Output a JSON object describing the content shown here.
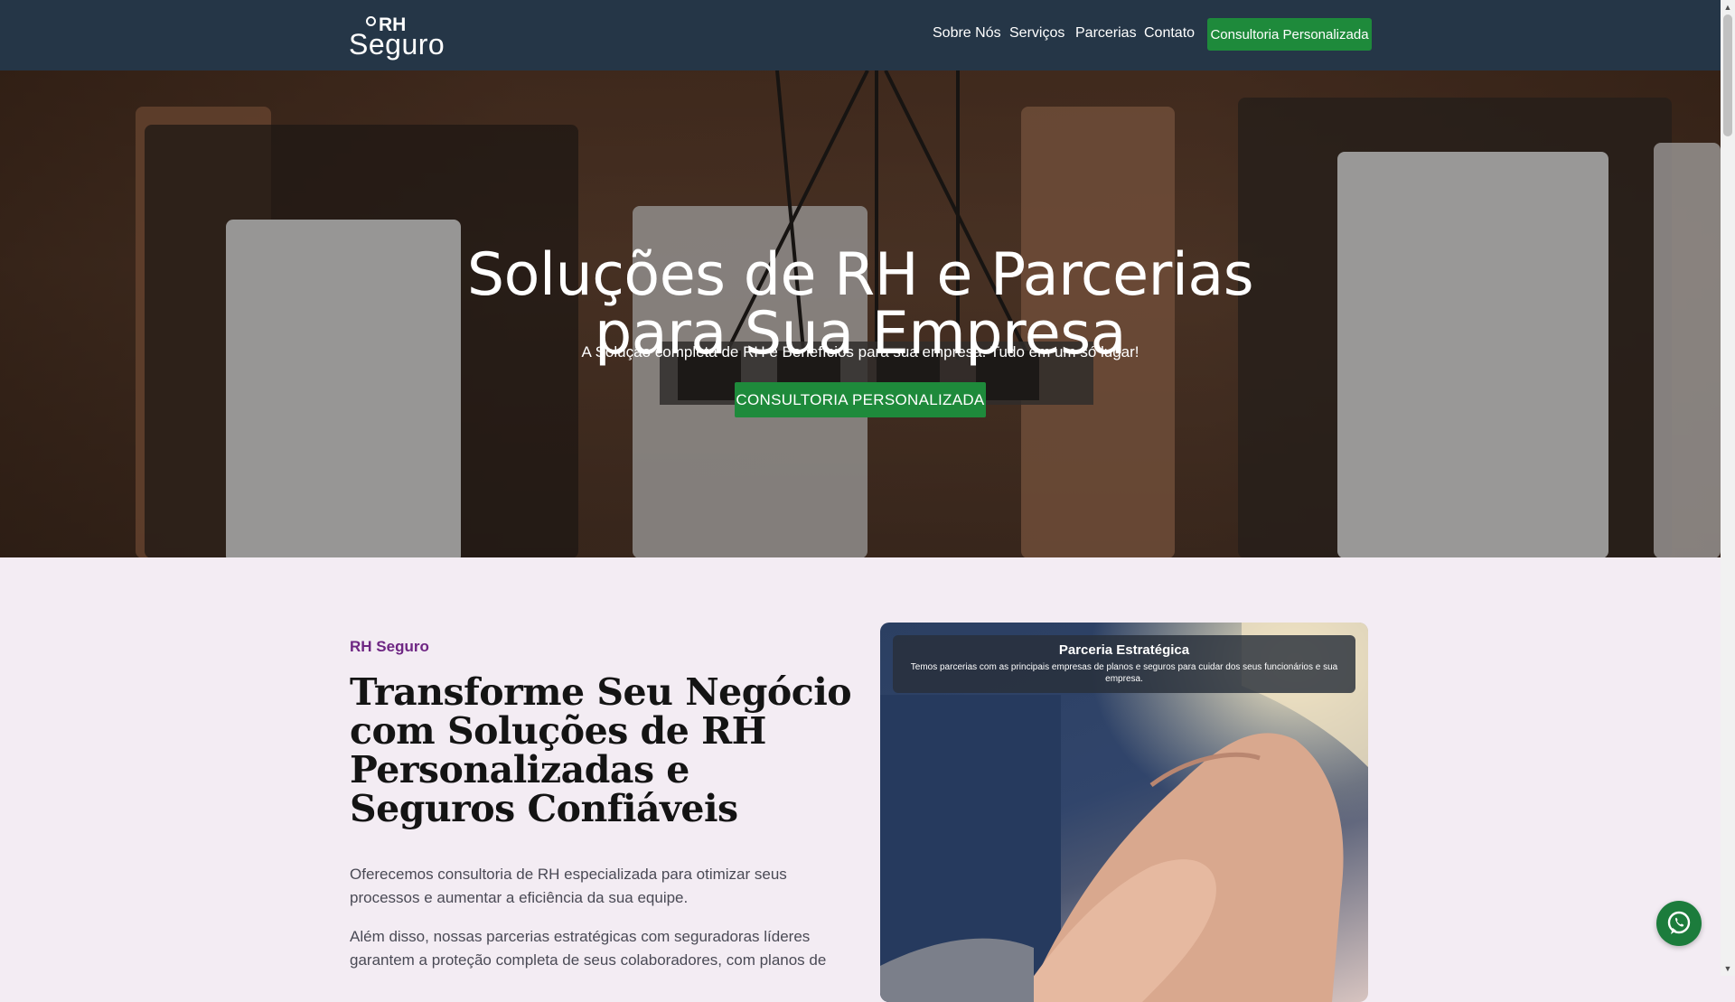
{
  "nav": {
    "logo_top": "RH",
    "logo_bottom": "Seguro",
    "links": [
      "Sobre Nós",
      "Serviços",
      "Parcerias",
      "Contato"
    ],
    "cta": "Consultoria Personalizada"
  },
  "hero": {
    "title_line1": "Soluções de RH e Parcerias",
    "title_line2": "para Sua Empresa",
    "subtitle": "A Solução completa de RH e Benefícios para sua empresa. Tudo em um só lugar!",
    "button": "CONSULTORIA PERSONALIZADA"
  },
  "about": {
    "kicker": "RH Seguro",
    "title": "Transforme Seu Negócio com Soluções de RH Personalizadas e Seguros Confiáveis",
    "paragraphs": [
      "Oferecemos consultoria de RH especializada para otimizar seus processos e aumentar a eficiência da sua equipe.",
      "Além disso, nossas parcerias estratégicas com seguradoras líderes garantem a proteção completa de seus colaboradores, com planos de"
    ],
    "card": {
      "title": "Parceria Estratégica",
      "text": "Temos parcerias com as principais empresas de planos e seguros para cuidar dos seus funcionários e sua empresa."
    }
  },
  "colors": {
    "navbar": "#253647",
    "cta_green": "#1e8a3b",
    "kicker_purple": "#6e2683",
    "page_bg": "#f3ecf3"
  },
  "icons": {
    "whatsapp": "whatsapp-icon"
  }
}
